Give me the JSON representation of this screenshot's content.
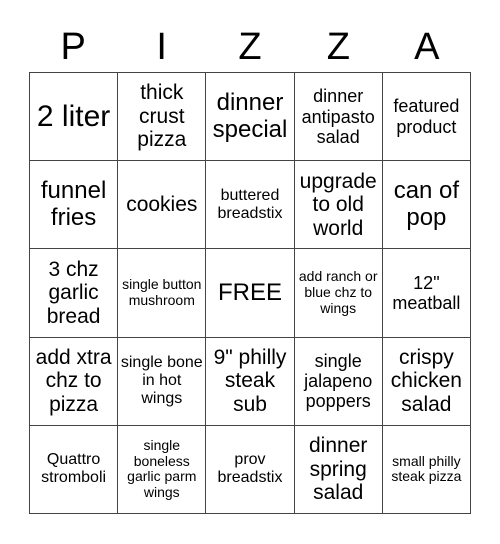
{
  "title_letters": [
    "P",
    "I",
    "Z",
    "Z",
    "A"
  ],
  "cells": [
    {
      "text": "2 liter",
      "size": "s1"
    },
    {
      "text": "thick crust pizza",
      "size": "s3"
    },
    {
      "text": "dinner special",
      "size": "s2"
    },
    {
      "text": "dinner antipasto salad",
      "size": "s4"
    },
    {
      "text": "featured product",
      "size": "s4"
    },
    {
      "text": "funnel fries",
      "size": "s2"
    },
    {
      "text": "cookies",
      "size": "s3"
    },
    {
      "text": "buttered breadstix",
      "size": "s5"
    },
    {
      "text": "upgrade to old world",
      "size": "s3"
    },
    {
      "text": "can of pop",
      "size": "s2"
    },
    {
      "text": "3 chz garlic bread",
      "size": "s3"
    },
    {
      "text": "single button mushroom",
      "size": "s6"
    },
    {
      "text": "FREE",
      "size": "s2"
    },
    {
      "text": "add ranch or blue chz to wings",
      "size": "s6"
    },
    {
      "text": "12\" meatball",
      "size": "s4"
    },
    {
      "text": "add xtra chz to pizza",
      "size": "s3"
    },
    {
      "text": "single bone in hot wings",
      "size": "s5"
    },
    {
      "text": "9\" philly steak sub",
      "size": "s3"
    },
    {
      "text": "single jalapeno poppers",
      "size": "s4"
    },
    {
      "text": "crispy chicken salad",
      "size": "s3"
    },
    {
      "text": "Quattro stromboli",
      "size": "s5"
    },
    {
      "text": "single boneless garlic parm wings",
      "size": "s6"
    },
    {
      "text": "prov breadstix",
      "size": "s5"
    },
    {
      "text": "dinner spring salad",
      "size": "s3"
    },
    {
      "text": "small philly steak pizza",
      "size": "s6"
    }
  ]
}
